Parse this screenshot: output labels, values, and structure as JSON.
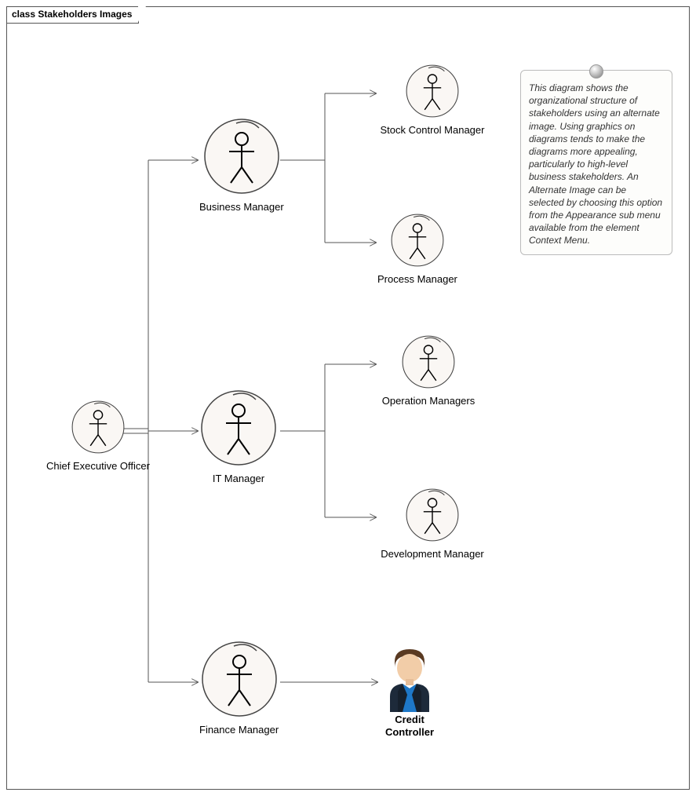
{
  "title": "class Stakeholders Images",
  "actors": {
    "ceo": "Chief Executive Officer",
    "business_manager": "Business Manager",
    "it_manager": "IT Manager",
    "finance_manager": "Finance Manager",
    "stock_control_manager": "Stock Control Manager",
    "process_manager": "Process Manager",
    "operation_managers": "Operation Managers",
    "development_manager": "Development Manager",
    "credit_controller": "Credit Controller"
  },
  "note_text": "This diagram shows the organizational structure of stakeholders using an alternate image. Using graphics on diagrams tends to make the diagrams more appealing, particularly to high-level business stakeholders. An Alternate Image can be selected by choosing this option from the Appearance sub menu available from the element Context Menu.",
  "hierarchy": {
    "root": "ceo",
    "children": {
      "ceo": [
        "business_manager",
        "it_manager",
        "finance_manager"
      ],
      "business_manager": [
        "stock_control_manager",
        "process_manager"
      ],
      "it_manager": [
        "operation_managers",
        "development_manager"
      ],
      "finance_manager": [
        "credit_controller"
      ]
    }
  }
}
